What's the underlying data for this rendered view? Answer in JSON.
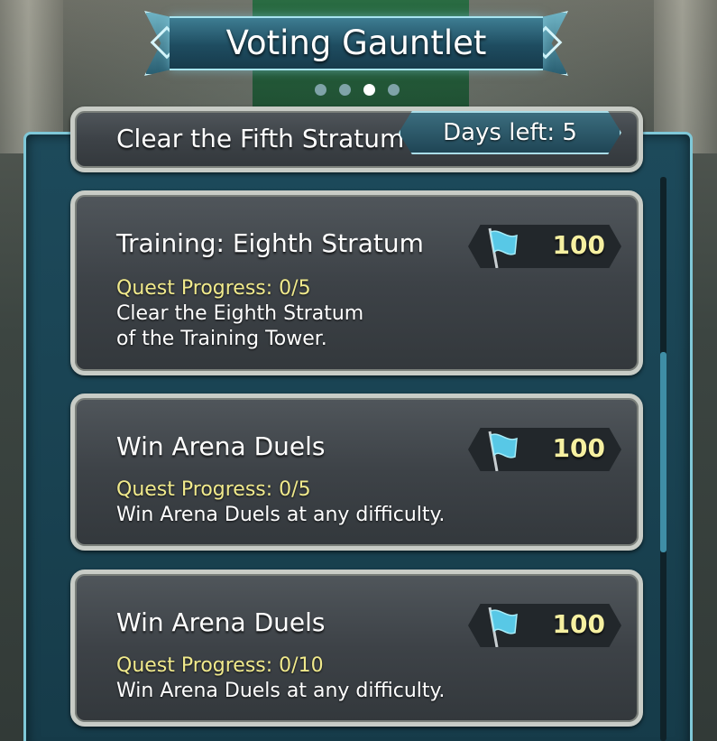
{
  "header": {
    "title": "Voting Gauntlet",
    "page_dots": 4,
    "active_dot": 3
  },
  "days_left": "Days left: 5",
  "quests": [
    {
      "title": "Clear the Fifth Stratum of the",
      "partial": true
    },
    {
      "title": "Training: Eighth Stratum",
      "progress": "Quest Progress: 0/5",
      "desc_line1": "Clear the Eighth Stratum",
      "desc_line2": "of the Training Tower.",
      "reward": "100",
      "reward_icon": "blue-flag-icon"
    },
    {
      "title": "Win Arena Duels",
      "progress": "Quest Progress: 0/5",
      "desc_line1": "Win Arena Duels at any difficulty.",
      "desc_line2": "",
      "reward": "100",
      "reward_icon": "blue-flag-icon"
    },
    {
      "title": "Win Arena Duels",
      "progress": "Quest Progress: 0/10",
      "desc_line1": "Win Arena Duels at any difficulty.",
      "desc_line2": "",
      "reward": "100",
      "reward_icon": "blue-flag-icon"
    }
  ],
  "colors": {
    "progress_text": "#f1ea8c",
    "reward_text": "#f6f0a1",
    "panel_border": "#7fc8d8",
    "flag": "#58c8e6"
  }
}
